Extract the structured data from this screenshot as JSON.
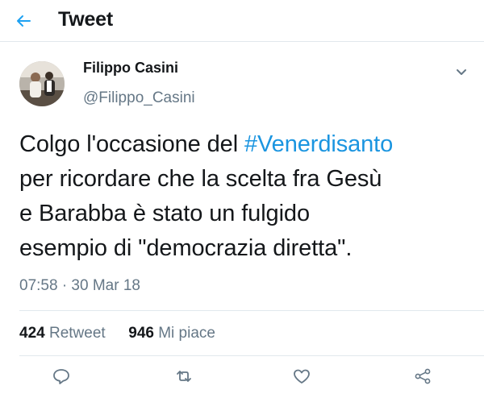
{
  "header": {
    "title": "Tweet",
    "back_icon": "arrow-left-icon"
  },
  "author": {
    "name": "Filippo Casini",
    "handle": "@Filippo_Casini",
    "menu_icon": "chevron-down-icon"
  },
  "tweet": {
    "text_before": "Colgo l'occasione del ",
    "hashtag": "#Venerdisanto",
    "text_line2": "per ricordare che la scelta fra Gesù",
    "text_line3": "e Barabba è stato un fulgido",
    "text_line4": "esempio di \"democrazia diretta\".",
    "timestamp": "07:58 · 30 Mar 18"
  },
  "stats": {
    "retweet_count": "424",
    "retweet_label": "Retweet",
    "like_count": "946",
    "like_label": "Mi piace"
  },
  "actions": {
    "reply_icon": "reply-icon",
    "retweet_icon": "retweet-icon",
    "like_icon": "heart-icon",
    "share_icon": "share-icon"
  },
  "colors": {
    "hashtag": "#1b95e0",
    "back_arrow": "#1da1f2",
    "secondary_text": "#657786",
    "divider": "#e1e8ed"
  }
}
